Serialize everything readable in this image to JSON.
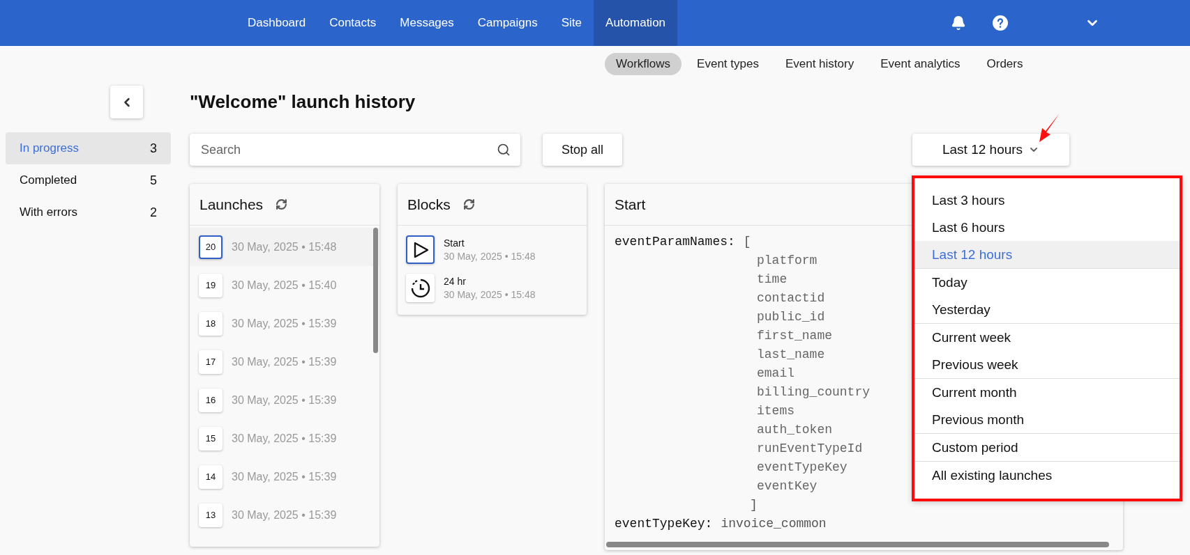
{
  "nav": {
    "items": [
      {
        "label": "Dashboard",
        "selected": false
      },
      {
        "label": "Contacts",
        "selected": false
      },
      {
        "label": "Messages",
        "selected": false
      },
      {
        "label": "Campaigns",
        "selected": false
      },
      {
        "label": "Site",
        "selected": false
      },
      {
        "label": "Automation",
        "selected": true
      }
    ]
  },
  "subnav": {
    "tabs": [
      {
        "label": "Workflows",
        "selected": true
      },
      {
        "label": "Event types",
        "selected": false
      },
      {
        "label": "Event history",
        "selected": false
      },
      {
        "label": "Event analytics",
        "selected": false
      },
      {
        "label": "Orders",
        "selected": false
      }
    ]
  },
  "sidebar": {
    "items": [
      {
        "label": "In progress",
        "count": "3",
        "selected": true
      },
      {
        "label": "Completed",
        "count": "5",
        "selected": false
      },
      {
        "label": "With errors",
        "count": "2",
        "selected": false
      }
    ]
  },
  "title": "\"Welcome\" launch history",
  "search": {
    "placeholder": "Search"
  },
  "stop_button": "Stop all",
  "period_button": "Last 12 hours",
  "launches": {
    "title": "Launches",
    "items": [
      {
        "number": "20",
        "time": "30 May, 2025 • 15:48",
        "selected": true
      },
      {
        "number": "19",
        "time": "30 May, 2025 • 15:40",
        "selected": false
      },
      {
        "number": "18",
        "time": "30 May, 2025 • 15:39",
        "selected": false
      },
      {
        "number": "17",
        "time": "30 May, 2025 • 15:39",
        "selected": false
      },
      {
        "number": "16",
        "time": "30 May, 2025 • 15:39",
        "selected": false
      },
      {
        "number": "15",
        "time": "30 May, 2025 • 15:39",
        "selected": false
      },
      {
        "number": "14",
        "time": "30 May, 2025 • 15:39",
        "selected": false
      },
      {
        "number": "13",
        "time": "30 May, 2025 • 15:39",
        "selected": false
      }
    ]
  },
  "blocks": {
    "title": "Blocks",
    "items": [
      {
        "kind": "start",
        "name": "Start",
        "time": "30 May, 2025 • 15:48",
        "selected": true
      },
      {
        "kind": "timer",
        "name": "24 hr",
        "time": "30 May, 2025 • 15:48",
        "selected": false
      }
    ]
  },
  "detail": {
    "title": "Start",
    "params_key": "eventParamNames:",
    "open_bracket": "[",
    "params": [
      "platform",
      "time",
      "contactid",
      "public_id",
      "first_name",
      "last_name",
      "email",
      "billing_country",
      "items",
      "auth_token",
      "runEventTypeId",
      "eventTypeKey",
      "eventKey"
    ],
    "close_bracket": "]",
    "fields": [
      {
        "key": "eventTypeKey:",
        "value": "invoice_common"
      }
    ]
  },
  "dropdown": {
    "groups": [
      {
        "items": [
          {
            "label": "Last 3 hours",
            "selected": false
          },
          {
            "label": "Last 6 hours",
            "selected": false
          },
          {
            "label": "Last 12 hours",
            "selected": true
          }
        ]
      },
      {
        "items": [
          {
            "label": "Today",
            "selected": false
          },
          {
            "label": "Yesterday",
            "selected": false
          }
        ]
      },
      {
        "items": [
          {
            "label": "Current week",
            "selected": false
          },
          {
            "label": "Previous week",
            "selected": false
          }
        ]
      },
      {
        "items": [
          {
            "label": "Current month",
            "selected": false
          },
          {
            "label": "Previous month",
            "selected": false
          }
        ]
      },
      {
        "items": [
          {
            "label": "Custom period",
            "selected": false
          }
        ]
      },
      {
        "items": [
          {
            "label": "All existing launches",
            "selected": false
          }
        ]
      }
    ]
  }
}
